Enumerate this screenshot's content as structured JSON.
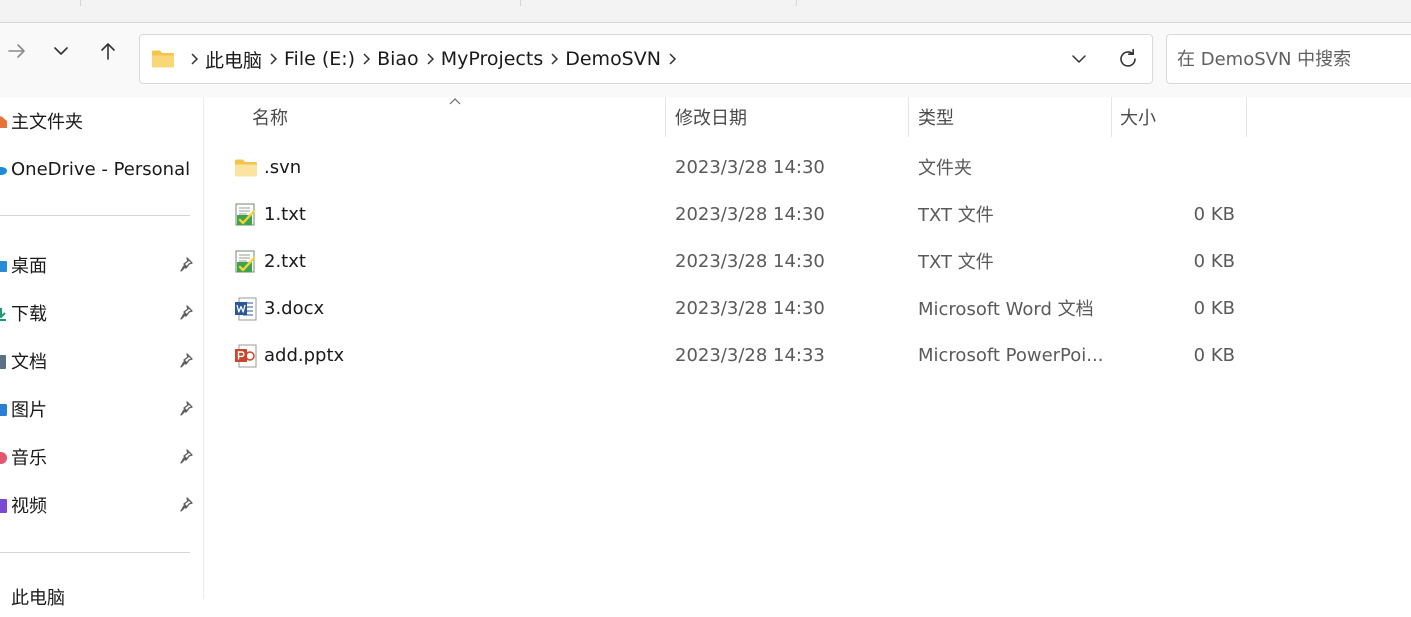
{
  "window": {
    "nav": {
      "forward_icon": "arrow-right-icon",
      "recent_icon": "chevron-down-icon",
      "up_icon": "arrow-up-icon"
    },
    "address": {
      "folder_icon": "folder-icon",
      "crumbs": [
        "此电脑",
        "File (E:)",
        "Biao",
        "MyProjects",
        "DemoSVN"
      ],
      "dropdown_icon": "chevron-down-icon",
      "refresh_icon": "refresh-icon"
    },
    "search": {
      "placeholder": "在 DemoSVN 中搜索"
    }
  },
  "sidebar": {
    "quick": [
      {
        "label": "主文件夹",
        "icon": "home-icon",
        "color": "#e8733a"
      },
      {
        "label": "OneDrive - Personal",
        "icon": "cloud-icon",
        "color": "#1c8bd9"
      }
    ],
    "pinned": [
      {
        "label": "桌面",
        "icon": "desktop-icon",
        "color": "#2b8ad8"
      },
      {
        "label": "下载",
        "icon": "download-icon",
        "color": "#1f9b73"
      },
      {
        "label": "文档",
        "icon": "document-icon",
        "color": "#5b7083"
      },
      {
        "label": "图片",
        "icon": "pictures-icon",
        "color": "#2a7fd4"
      },
      {
        "label": "音乐",
        "icon": "music-icon",
        "color": "#e2566f"
      },
      {
        "label": "视频",
        "icon": "video-icon",
        "color": "#7a4bd1"
      }
    ],
    "this_pc": {
      "label": "此电脑",
      "icon": "pc-icon"
    }
  },
  "columns": {
    "name": "名称",
    "date": "修改日期",
    "type": "类型",
    "size": "大小"
  },
  "files": [
    {
      "name": ".svn",
      "date": "2023/3/28 14:30",
      "type": "文件夹",
      "size": "",
      "icon": "folder-icon"
    },
    {
      "name": "1.txt",
      "date": "2023/3/28 14:30",
      "type": "TXT 文件",
      "size": "0 KB",
      "icon": "svn-txt-icon"
    },
    {
      "name": "2.txt",
      "date": "2023/3/28 14:30",
      "type": "TXT 文件",
      "size": "0 KB",
      "icon": "svn-txt-icon"
    },
    {
      "name": "3.docx",
      "date": "2023/3/28 14:30",
      "type": "Microsoft Word 文档",
      "size": "0 KB",
      "icon": "word-icon"
    },
    {
      "name": "add.pptx",
      "date": "2023/3/28 14:33",
      "type": "Microsoft PowerPoi...",
      "size": "0 KB",
      "icon": "powerpoint-icon"
    }
  ]
}
